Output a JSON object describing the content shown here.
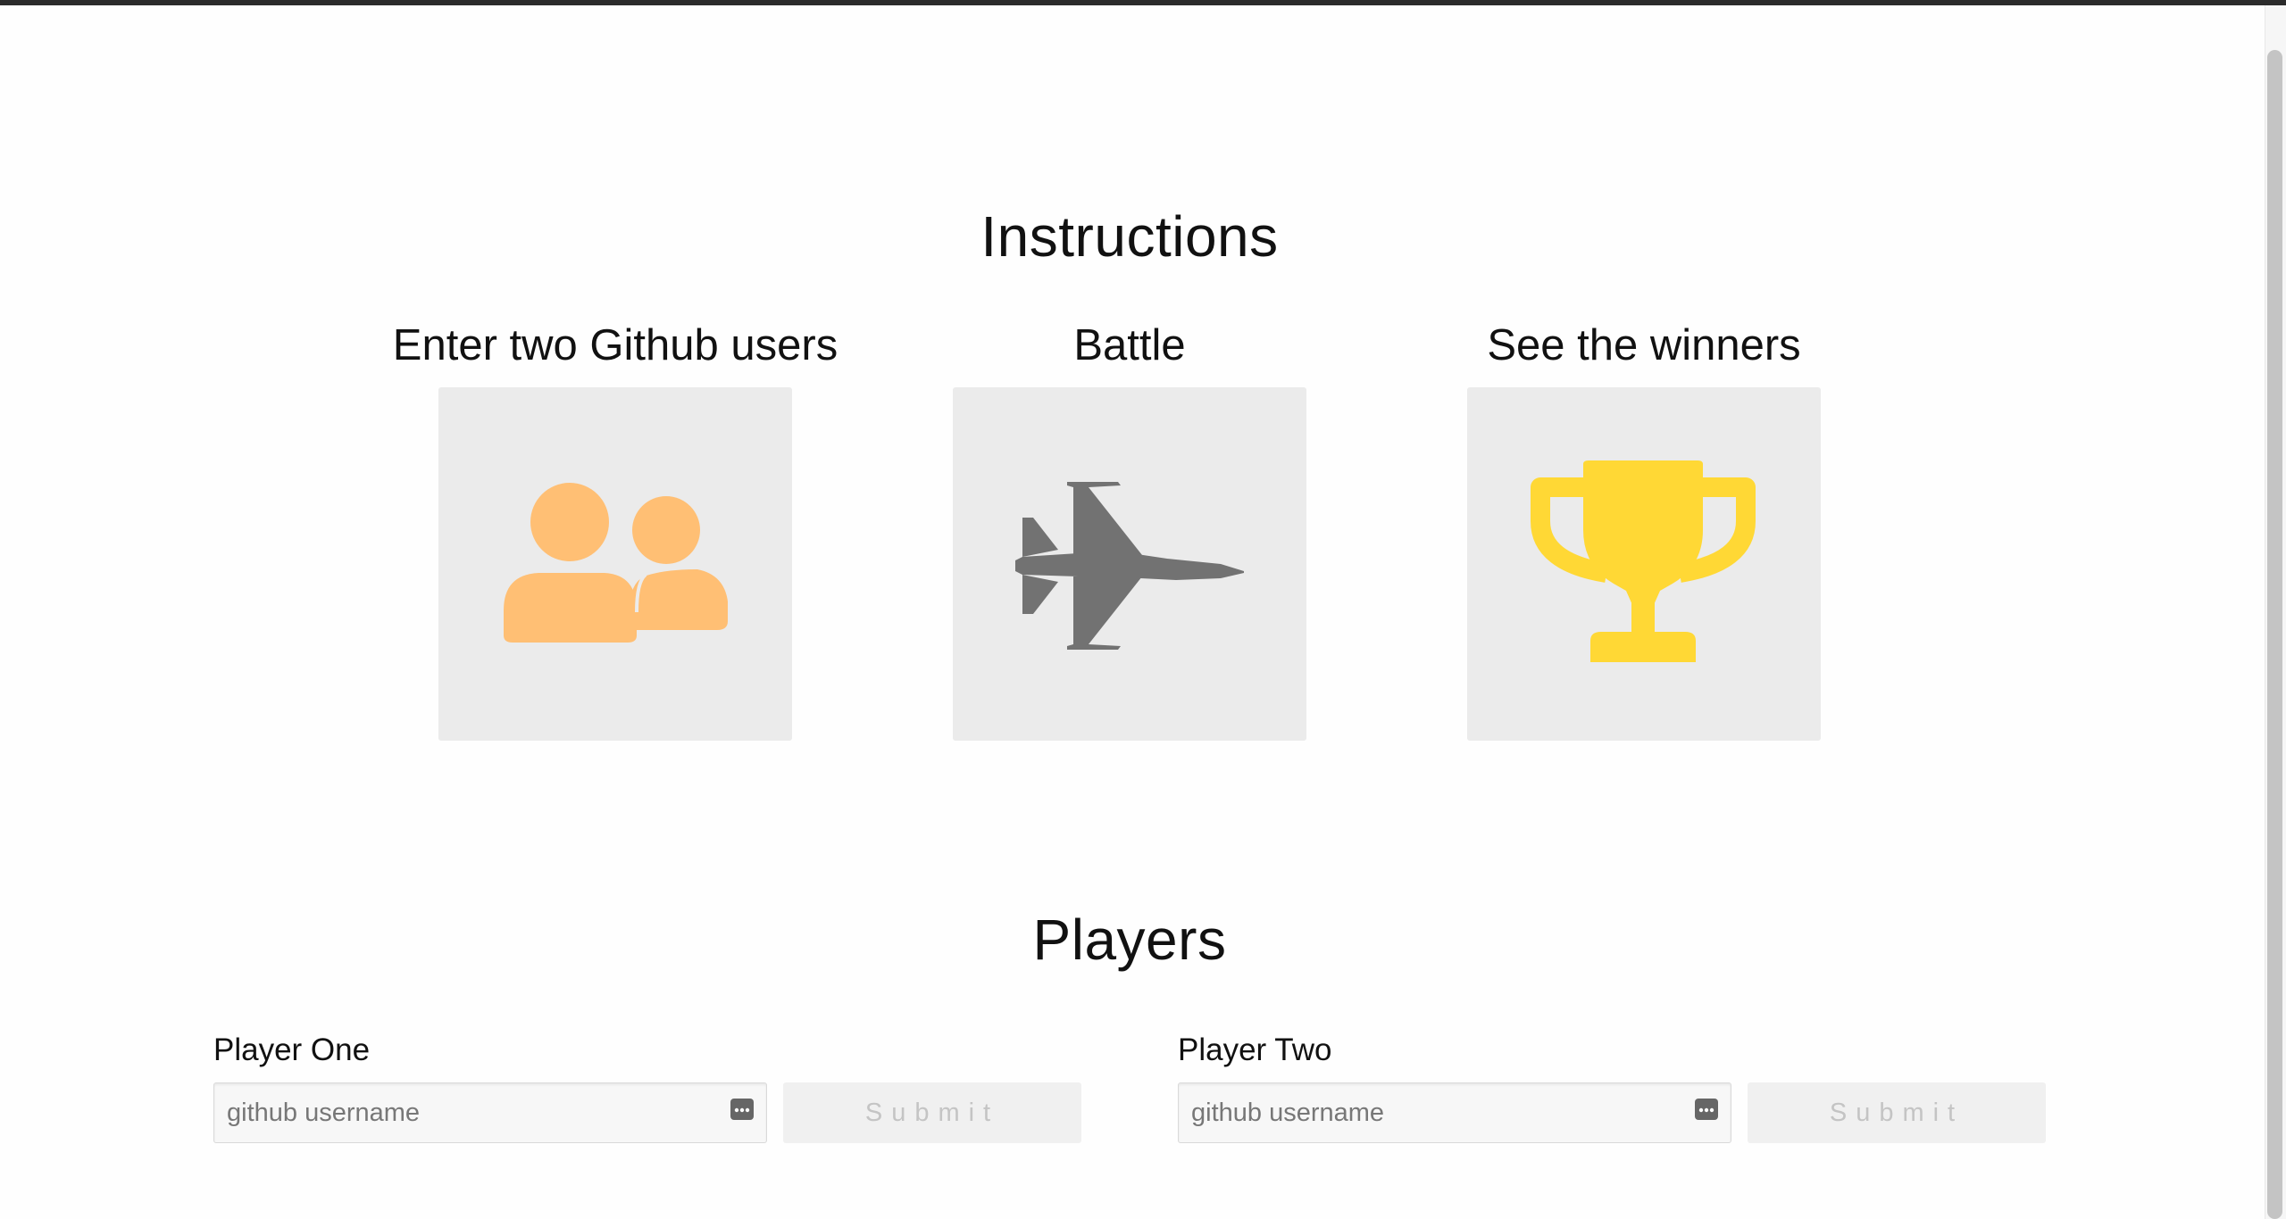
{
  "instructions": {
    "title": "Instructions",
    "steps": [
      {
        "label": "Enter two Github users",
        "icon": "users-icon",
        "color": "#ffbf74"
      },
      {
        "label": "Battle",
        "icon": "fighter-jet-icon",
        "color": "#727272"
      },
      {
        "label": "See the winners",
        "icon": "trophy-icon",
        "color": "#ffd835"
      }
    ]
  },
  "players": {
    "title": "Players",
    "player_one": {
      "label": "Player One",
      "placeholder": "github username",
      "submit_label": "Submit"
    },
    "player_two": {
      "label": "Player Two",
      "placeholder": "github username",
      "submit_label": "Submit"
    }
  }
}
